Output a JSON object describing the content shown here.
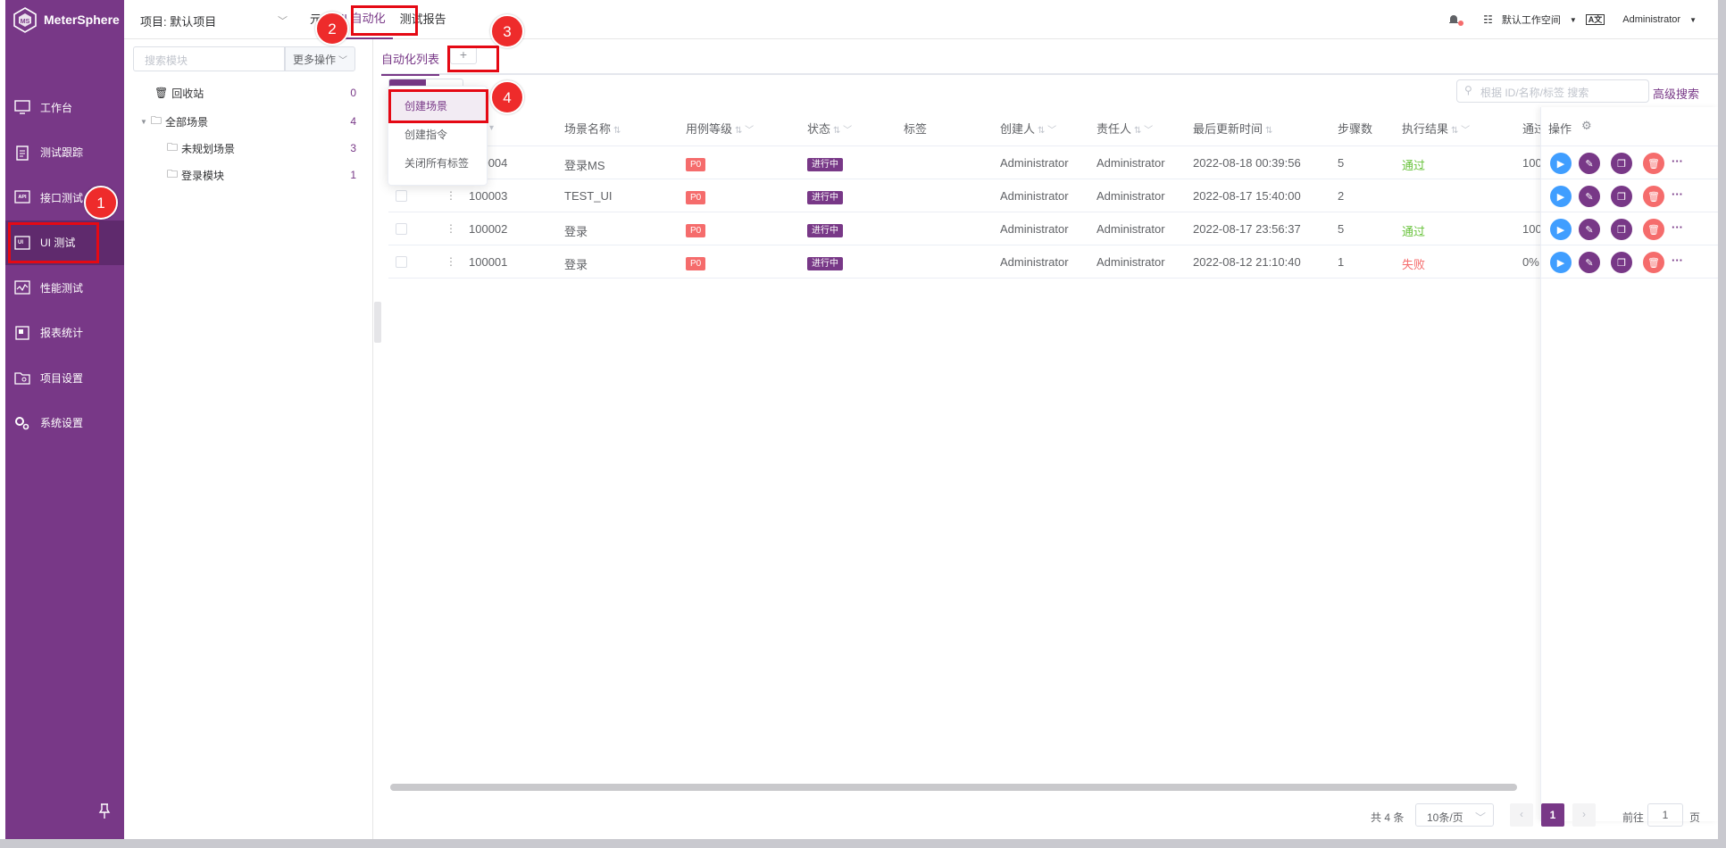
{
  "brand": {
    "name": "MeterSphere",
    "color": "#783887"
  },
  "sidebar": {
    "items": [
      {
        "label": "工作台",
        "icon": "monitor-icon"
      },
      {
        "label": "测试跟踪",
        "icon": "clipboard-icon"
      },
      {
        "label": "接口测试",
        "icon": "api-icon"
      },
      {
        "label": "UI 测试",
        "icon": "ui-icon"
      },
      {
        "label": "性能测试",
        "icon": "performance-icon"
      },
      {
        "label": "报表统计",
        "icon": "report-icon"
      },
      {
        "label": "项目设置",
        "icon": "folder-settings-icon"
      },
      {
        "label": "系统设置",
        "icon": "gear-icon"
      }
    ],
    "active_index": 3
  },
  "header": {
    "project": "项目: 默认项目",
    "menu": [
      "元",
      "UI 自动化",
      "测试报告"
    ],
    "active_menu": 1,
    "workspace": "默认工作空间",
    "lang": "A文",
    "user": "Administrator"
  },
  "tree": {
    "search_placeholder": "搜索模块",
    "more_ops": "更多操作",
    "recycle": {
      "label": "回收站",
      "count": "0"
    },
    "root": {
      "label": "全部场景",
      "count": "4"
    },
    "children": [
      {
        "label": "未规划场景",
        "count": "3"
      },
      {
        "label": "登录模块",
        "count": "1"
      }
    ]
  },
  "tabs": {
    "list_label": "自动化列表",
    "add_label": "+"
  },
  "search": {
    "placeholder": "根据 ID/名称/标签 搜索",
    "advanced": "高级搜索"
  },
  "dropdown": {
    "items": [
      "创建场景",
      "创建指令",
      "关闭所有标签"
    ]
  },
  "table": {
    "columns": [
      "场景名称",
      "用例等级",
      "状态",
      "标签",
      "创建人",
      "责任人",
      "最后更新时间",
      "步骤数",
      "执行结果",
      "通过"
    ],
    "rows": [
      {
        "id": "100004",
        "name": "登录MS",
        "level": "P0",
        "status": "进行中",
        "creator": "Administrator",
        "owner": "Administrator",
        "updated": "2022-08-18 00:39:56",
        "steps": "5",
        "result": "通过",
        "result_type": "pass",
        "pass": "100"
      },
      {
        "id": "100003",
        "name": "TEST_UI",
        "level": "P0",
        "status": "进行中",
        "creator": "Administrator",
        "owner": "Administrator",
        "updated": "2022-08-17 15:40:00",
        "steps": "2",
        "result": "",
        "result_type": "none",
        "pass": ""
      },
      {
        "id": "100002",
        "name": "登录",
        "level": "P0",
        "status": "进行中",
        "creator": "Administrator",
        "owner": "Administrator",
        "updated": "2022-08-17 23:56:37",
        "steps": "5",
        "result": "通过",
        "result_type": "pass",
        "pass": "100"
      },
      {
        "id": "100001",
        "name": "登录",
        "level": "P0",
        "status": "进行中",
        "creator": "Administrator",
        "owner": "Administrator",
        "updated": "2022-08-12 21:10:40",
        "steps": "1",
        "result": "失败",
        "result_type": "fail",
        "pass": "0%"
      }
    ],
    "ops_label": "操作"
  },
  "pager": {
    "total": "共 4 条",
    "size": "10条/页",
    "current": "1",
    "goto": "前往",
    "goto_value": "1",
    "unit": "页"
  },
  "annotations": [
    "1",
    "2",
    "3",
    "4"
  ]
}
